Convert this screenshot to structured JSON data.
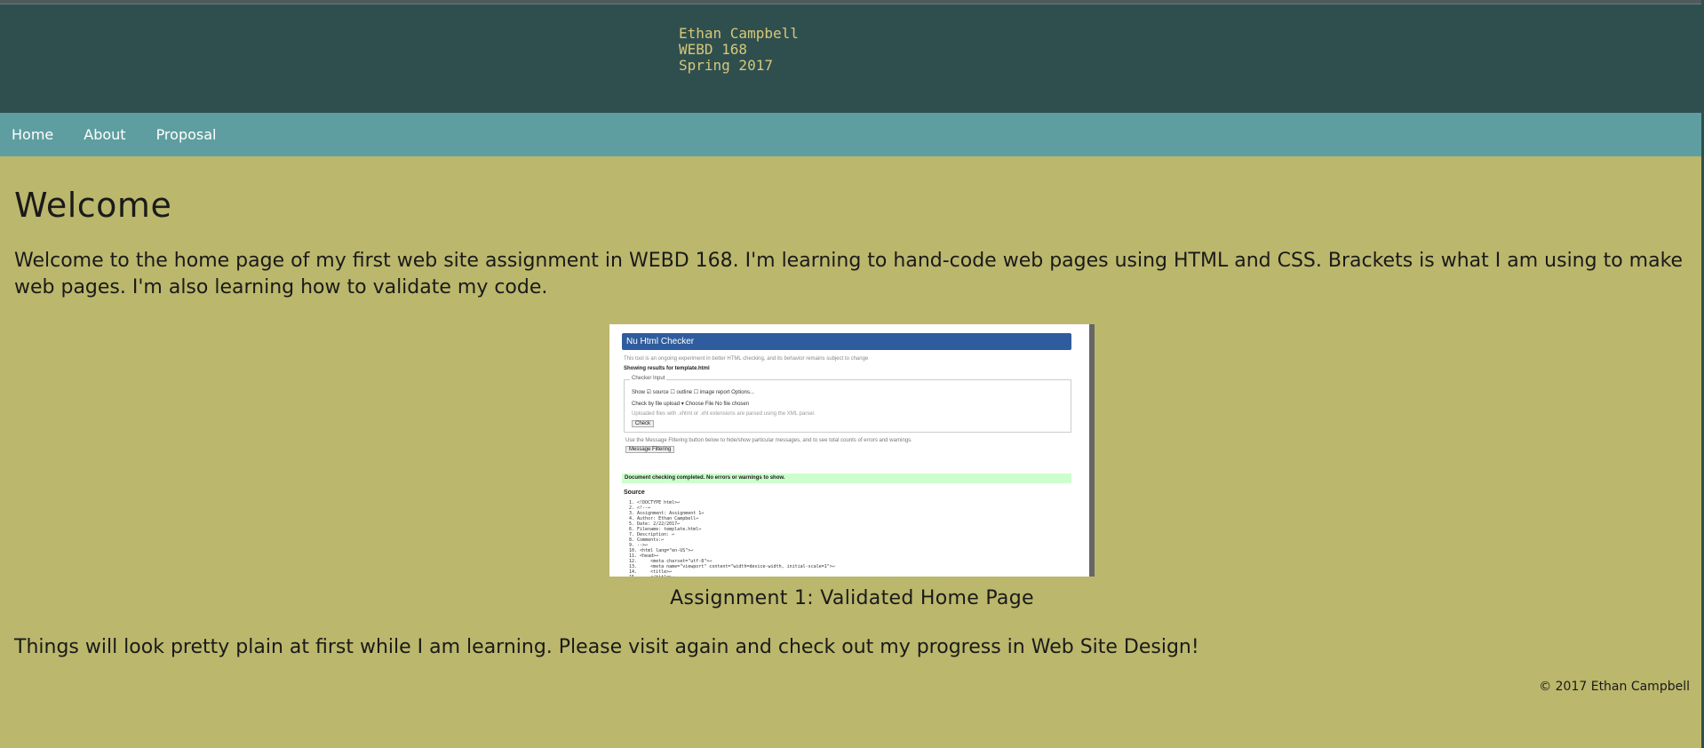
{
  "header": {
    "line1": "Ethan Campbell",
    "line2": "WEBD 168",
    "line3": "Spring 2017"
  },
  "nav": {
    "items": [
      {
        "label": "Home"
      },
      {
        "label": "About"
      },
      {
        "label": "Proposal"
      }
    ]
  },
  "main": {
    "heading": "Welcome",
    "intro": "Welcome to the home page of my first web site assignment in WEBD 168. I'm learning to hand-code web pages using HTML and CSS. Brackets is what I am using to make web pages. I'm also learning how to validate my code.",
    "figure": {
      "screenshot": {
        "title": "Nu Html Checker",
        "note": "This tool is an ongoing experiment in better HTML checking, and its behavior remains subject to change",
        "results": "Showing results for template.html",
        "checker_input": "Checker Input",
        "show_row": "Show  ☑ source  ☐ outline  ☐ image report   Options...",
        "check_by_row": "Check by  file upload ▾   Choose File  No file chosen",
        "uploaded_note": "Uploaded files with .xhtml or .xht extensions are parsed using the XML parser.",
        "check_button": "Check",
        "use_note": "Use the Message Filtering button below to hide/show particular messages, and to see total counts of errors and warnings.",
        "filter_button": "Message Filtering",
        "status": "Document checking completed. No errors or warnings to show.",
        "source_label": "Source",
        "source_code": "1. <!DOCTYPE html>↩\n2. <!--↩\n3. Assignment: Assignment 1↩\n4. Author: Ethan Campbell↩\n5. Date: 2/22/2017↩\n6. Filename: template.html↩\n7. Description: ↩\n8. Comments:↩\n9. -->↩\n10. <html lang=\"en-US\">↩\n11. <head>↩\n12.     <meta charset=\"utf-8\">↩\n13.     <meta name=\"viewport\" content=\"width=device-width, initial-scale=1\">↩\n14.     <title>↩\n15.     </title>↩"
      },
      "caption": "Assignment 1: Validated Home Page"
    },
    "outro": "Things will look pretty plain at first while I am learning. Please visit again and check out my progress in Web Site Design!"
  },
  "footer": {
    "copyright": "© 2017 Ethan Campbell"
  },
  "colors": {
    "background": "#bbb76c",
    "banner": "#2f4f4f",
    "nav": "#5f9ea0",
    "header_text": "#d6c878"
  }
}
